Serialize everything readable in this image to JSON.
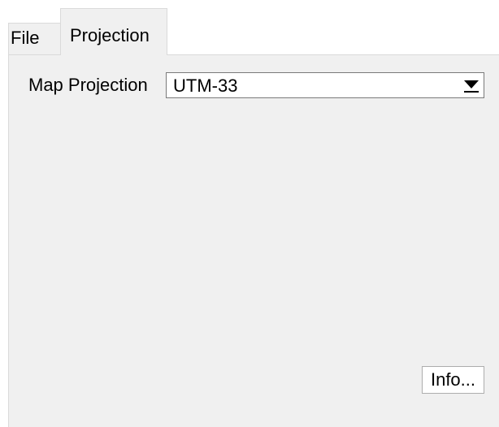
{
  "tabs": {
    "file_label": "File",
    "projection_label": "Projection"
  },
  "projection_panel": {
    "map_projection_label": "Map Projection",
    "map_projection_value": "UTM-33",
    "info_button_label": "Info..."
  },
  "icons": {
    "dropdown": "dropdown-arrow-icon"
  },
  "colors": {
    "window_background": "#ffffff",
    "panel_background": "#f0f0f0",
    "border": "#dadada",
    "field_background": "#ffffff"
  }
}
